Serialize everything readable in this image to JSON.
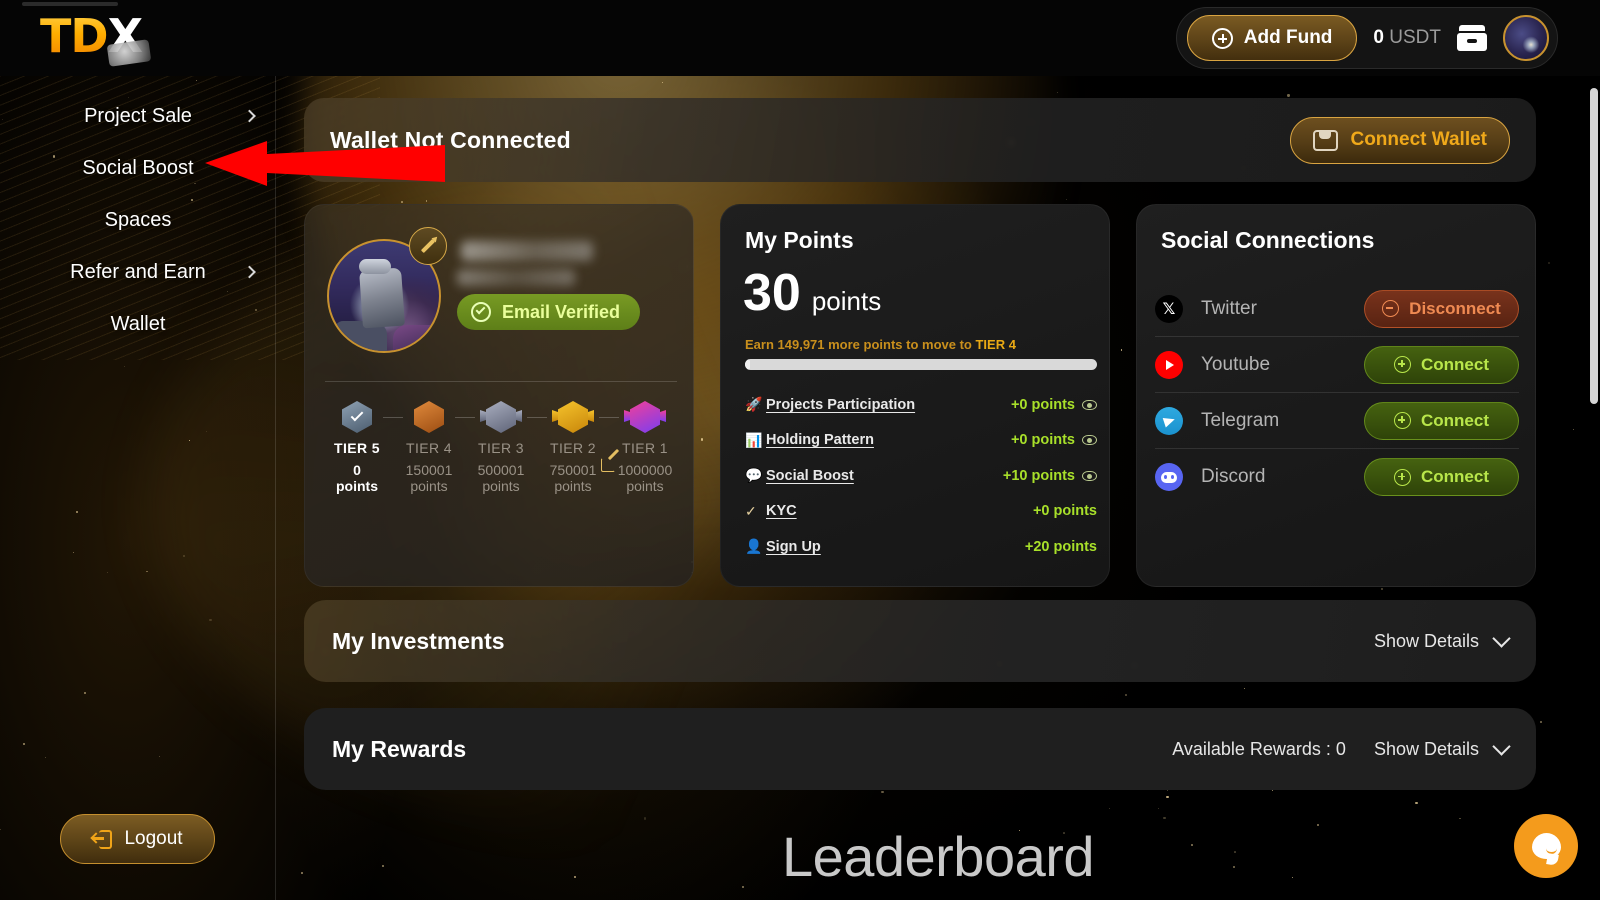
{
  "header": {
    "logo_td": "TD",
    "logo_x": "X",
    "add_fund_label": "Add Fund",
    "balance_amount": "0",
    "balance_currency": "USDT"
  },
  "sidebar": {
    "items": [
      {
        "label": "Project Sale",
        "has_chevron": true
      },
      {
        "label": "Social Boost",
        "has_chevron": false
      },
      {
        "label": "Spaces",
        "has_chevron": false
      },
      {
        "label": "Refer and Earn",
        "has_chevron": true
      },
      {
        "label": "Wallet",
        "has_chevron": false
      }
    ],
    "logout_label": "Logout"
  },
  "wallet_banner": {
    "title": "Wallet Not Connected",
    "connect_label": "Connect Wallet"
  },
  "profile": {
    "email_verified_label": "Email Verified",
    "tiers": [
      {
        "name": "TIER 5",
        "points": "0",
        "points_unit": "points",
        "active": true,
        "color_a": "#8fa2b4",
        "color_b": "#4b5c6e",
        "wings": false
      },
      {
        "name": "TIER 4",
        "points": "150001",
        "points_unit": "points",
        "active": false,
        "color_a": "#e08a3c",
        "color_b": "#9c4d12",
        "wings": false
      },
      {
        "name": "TIER 3",
        "points": "500001",
        "points_unit": "points",
        "active": false,
        "color_a": "#a9aebf",
        "color_b": "#5e6377",
        "wings": true
      },
      {
        "name": "TIER 2",
        "points": "750001",
        "points_unit": "points",
        "active": false,
        "color_a": "#f5c32c",
        "color_b": "#c8860a",
        "wings": true
      },
      {
        "name": "TIER 1",
        "points": "1000000",
        "points_unit": "points",
        "active": false,
        "color_a": "#f0409a",
        "color_b": "#7b3df0",
        "wings": true
      }
    ]
  },
  "points": {
    "title": "My Points",
    "value": "30",
    "unit": "points",
    "hint_prefix": "Earn 149,971 more points to move to ",
    "hint_tier": "TIER 4",
    "progress_percent": 1.5,
    "rows": [
      {
        "icon": "rocket-icon",
        "glyph": "🚀",
        "label": "Projects Participation",
        "value": "+0 points",
        "has_eye": true
      },
      {
        "icon": "bar-chart-icon",
        "glyph": "📊",
        "label": "Holding Pattern",
        "value": "+0 points",
        "has_eye": true
      },
      {
        "icon": "chat-icon",
        "glyph": "💬",
        "label": "Social Boost",
        "value": "+10 points",
        "has_eye": true
      },
      {
        "icon": "check-circle-icon",
        "glyph": "✓",
        "label": "KYC",
        "value": "+0 points",
        "has_eye": false
      },
      {
        "icon": "user-plus-icon",
        "glyph": "👤",
        "label": "Sign Up",
        "value": "+20 points",
        "has_eye": false
      }
    ]
  },
  "social": {
    "title": "Social Connections",
    "rows": [
      {
        "name": "Twitter",
        "icon": "twitter-x-icon",
        "action": "Disconnect",
        "connected": true
      },
      {
        "name": "Youtube",
        "icon": "youtube-icon",
        "action": "Connect",
        "connected": false
      },
      {
        "name": "Telegram",
        "icon": "telegram-icon",
        "action": "Connect",
        "connected": false
      },
      {
        "name": "Discord",
        "icon": "discord-icon",
        "action": "Connect",
        "connected": false
      }
    ]
  },
  "investments": {
    "title": "My Investments",
    "show_details_label": "Show Details"
  },
  "rewards": {
    "title": "My Rewards",
    "available_label": "Available Rewards : 0",
    "show_details_label": "Show Details"
  },
  "leaderboard": {
    "title": "Leaderboard"
  },
  "colors": {
    "accent_gold": "#f0a91a",
    "green_points": "#a8e02a",
    "disconnect_red": "#ef8a52",
    "annotation_red": "#ff0000",
    "chat_orange": "#f49b1c"
  }
}
